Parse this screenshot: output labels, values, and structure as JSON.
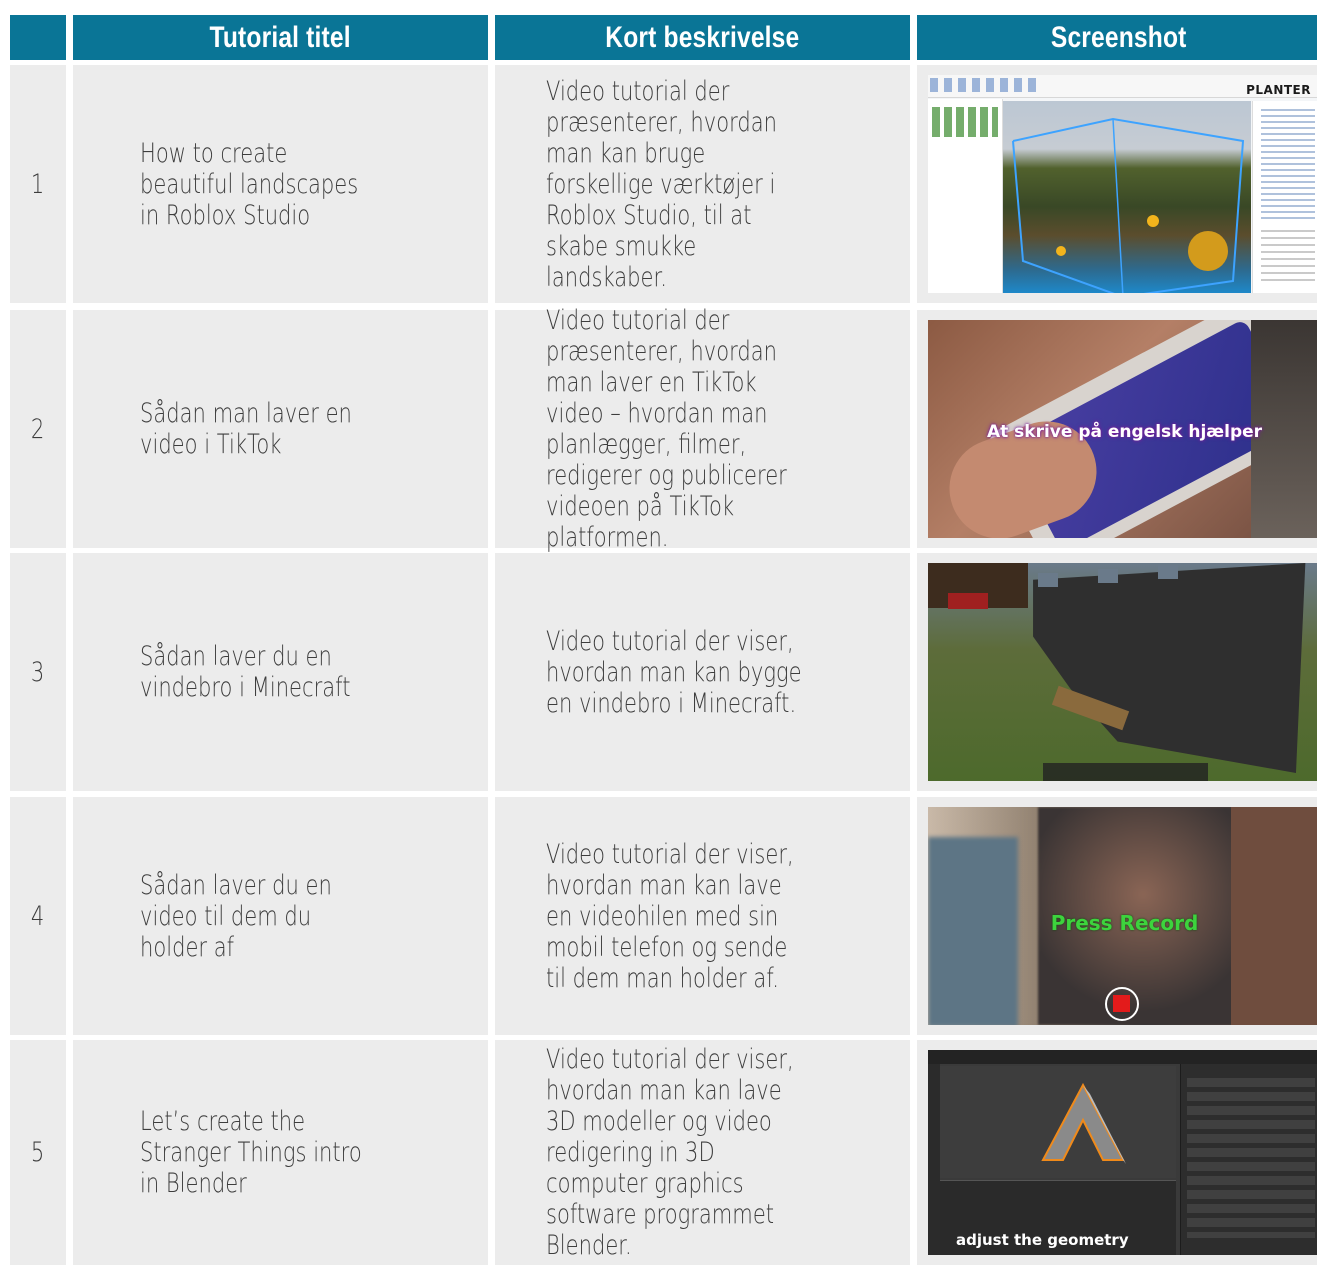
{
  "header": {
    "col_number": "",
    "col_title": "Tutorial titel",
    "col_description": "Kort beskrivelse",
    "col_screenshot": "Screenshot"
  },
  "rows": [
    {
      "number": "1",
      "title": "How to create beautiful landscapes in Roblox Studio",
      "description": "Video tutorial der præsenterer, hvordan man kan bruge forskellige værktøjer i Roblox Studio, til at skabe smukke landskaber.",
      "screenshot": {
        "caption": "PLANTER",
        "caption_color": "#1a1a1a"
      }
    },
    {
      "number": "2",
      "title": "Sådan man laver en video i TikTok",
      "description": "Video tutorial der præsenterer, hvordan man laver en TikTok video – hvordan man planlægger, filmer, redigerer og publicerer videoen på TikTok platformen.",
      "screenshot": {
        "caption": "At skrive på engelsk hjælper",
        "caption_color": "#ffffff"
      }
    },
    {
      "number": "3",
      "title": "Sådan laver du en vindebro i Minecraft",
      "description": "Video tutorial der viser, hvordan man kan bygge en vindebro i Minecraft.",
      "screenshot": {
        "caption": ""
      }
    },
    {
      "number": "4",
      "title": "Sådan laver du en video til dem du holder af",
      "description": "Video tutorial der viser, hvordan man kan lave en videohilen med sin mobil telefon og sende til dem man holder af.",
      "screenshot": {
        "caption": "Press Record",
        "caption_color": "#3dd33d"
      }
    },
    {
      "number": "5",
      "title": "Let’s create the Stranger Things intro in Blender",
      "description": "Video tutorial der viser, hvordan man kan lave 3D modeller og video redigering in 3D computer graphics software programmet Blender.",
      "screenshot": {
        "caption": "adjust the geometry",
        "caption_color": "#ffffff"
      }
    }
  ],
  "colors": {
    "header_bg": "#0a7596",
    "cell_bg": "#ececec",
    "text": "#3d3d3d"
  }
}
